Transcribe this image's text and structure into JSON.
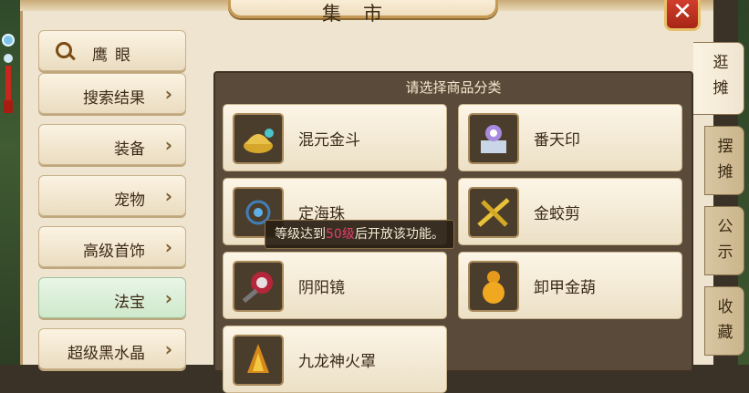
{
  "window": {
    "title": "集市"
  },
  "sidebar": {
    "search_label": "鹰眼",
    "items": [
      {
        "label": "搜索结果",
        "active": false
      },
      {
        "label": "装备",
        "active": false
      },
      {
        "label": "宠物",
        "active": false
      },
      {
        "label": "高级首饰",
        "active": false
      },
      {
        "label": "法宝",
        "active": true
      },
      {
        "label": "超级黑水晶",
        "active": false
      }
    ]
  },
  "goods": {
    "header": "请选择商品分类",
    "items": [
      {
        "name": "混元金斗",
        "icon": "golden-cauldron-icon"
      },
      {
        "name": "番天印",
        "icon": "seal-icon"
      },
      {
        "name": "定海珠",
        "icon": "pearl-icon"
      },
      {
        "name": "金蛟剪",
        "icon": "golden-scissors-icon"
      },
      {
        "name": "阴阳镜",
        "icon": "mirror-icon"
      },
      {
        "name": "卸甲金葫",
        "icon": "gourd-icon"
      },
      {
        "name": "九龙神火罩",
        "icon": "fire-cover-icon"
      }
    ]
  },
  "tooltip": {
    "prefix": "等级达到",
    "level": "50级",
    "suffix": "后开放该功能。"
  },
  "tabs": [
    {
      "label": "逛摊",
      "active": true
    },
    {
      "label": "摆摊",
      "active": false
    },
    {
      "label": "公示",
      "active": false
    },
    {
      "label": "收藏",
      "active": false
    }
  ],
  "close_label": "✕",
  "colors": {
    "accent": "#e0406a",
    "active_tab": "#cfe8cc",
    "panel": "#efe4cf"
  }
}
